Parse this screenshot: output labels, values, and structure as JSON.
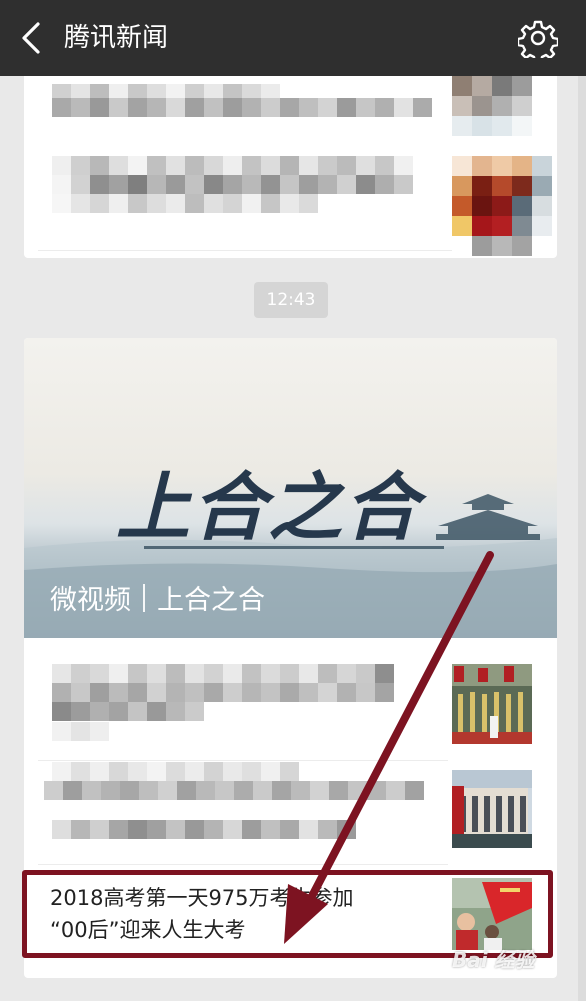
{
  "header": {
    "title": "腾讯新闻",
    "back_icon": "chevron-left-icon",
    "settings_icon": "gear-icon"
  },
  "timestamp": "12:43",
  "banner": {
    "title": "上合之合",
    "caption_left": "微视频",
    "caption_right": "上合之合"
  },
  "articles": [
    {
      "title_line1": "2018高考第一天975万考生参加",
      "title_line2": "“00后”迎来人生大考"
    }
  ],
  "watermark": "Bai 经验",
  "colors": {
    "header_bg": "#2f2f2f",
    "highlight": "#7d1321",
    "background": "#e9e9e9"
  }
}
